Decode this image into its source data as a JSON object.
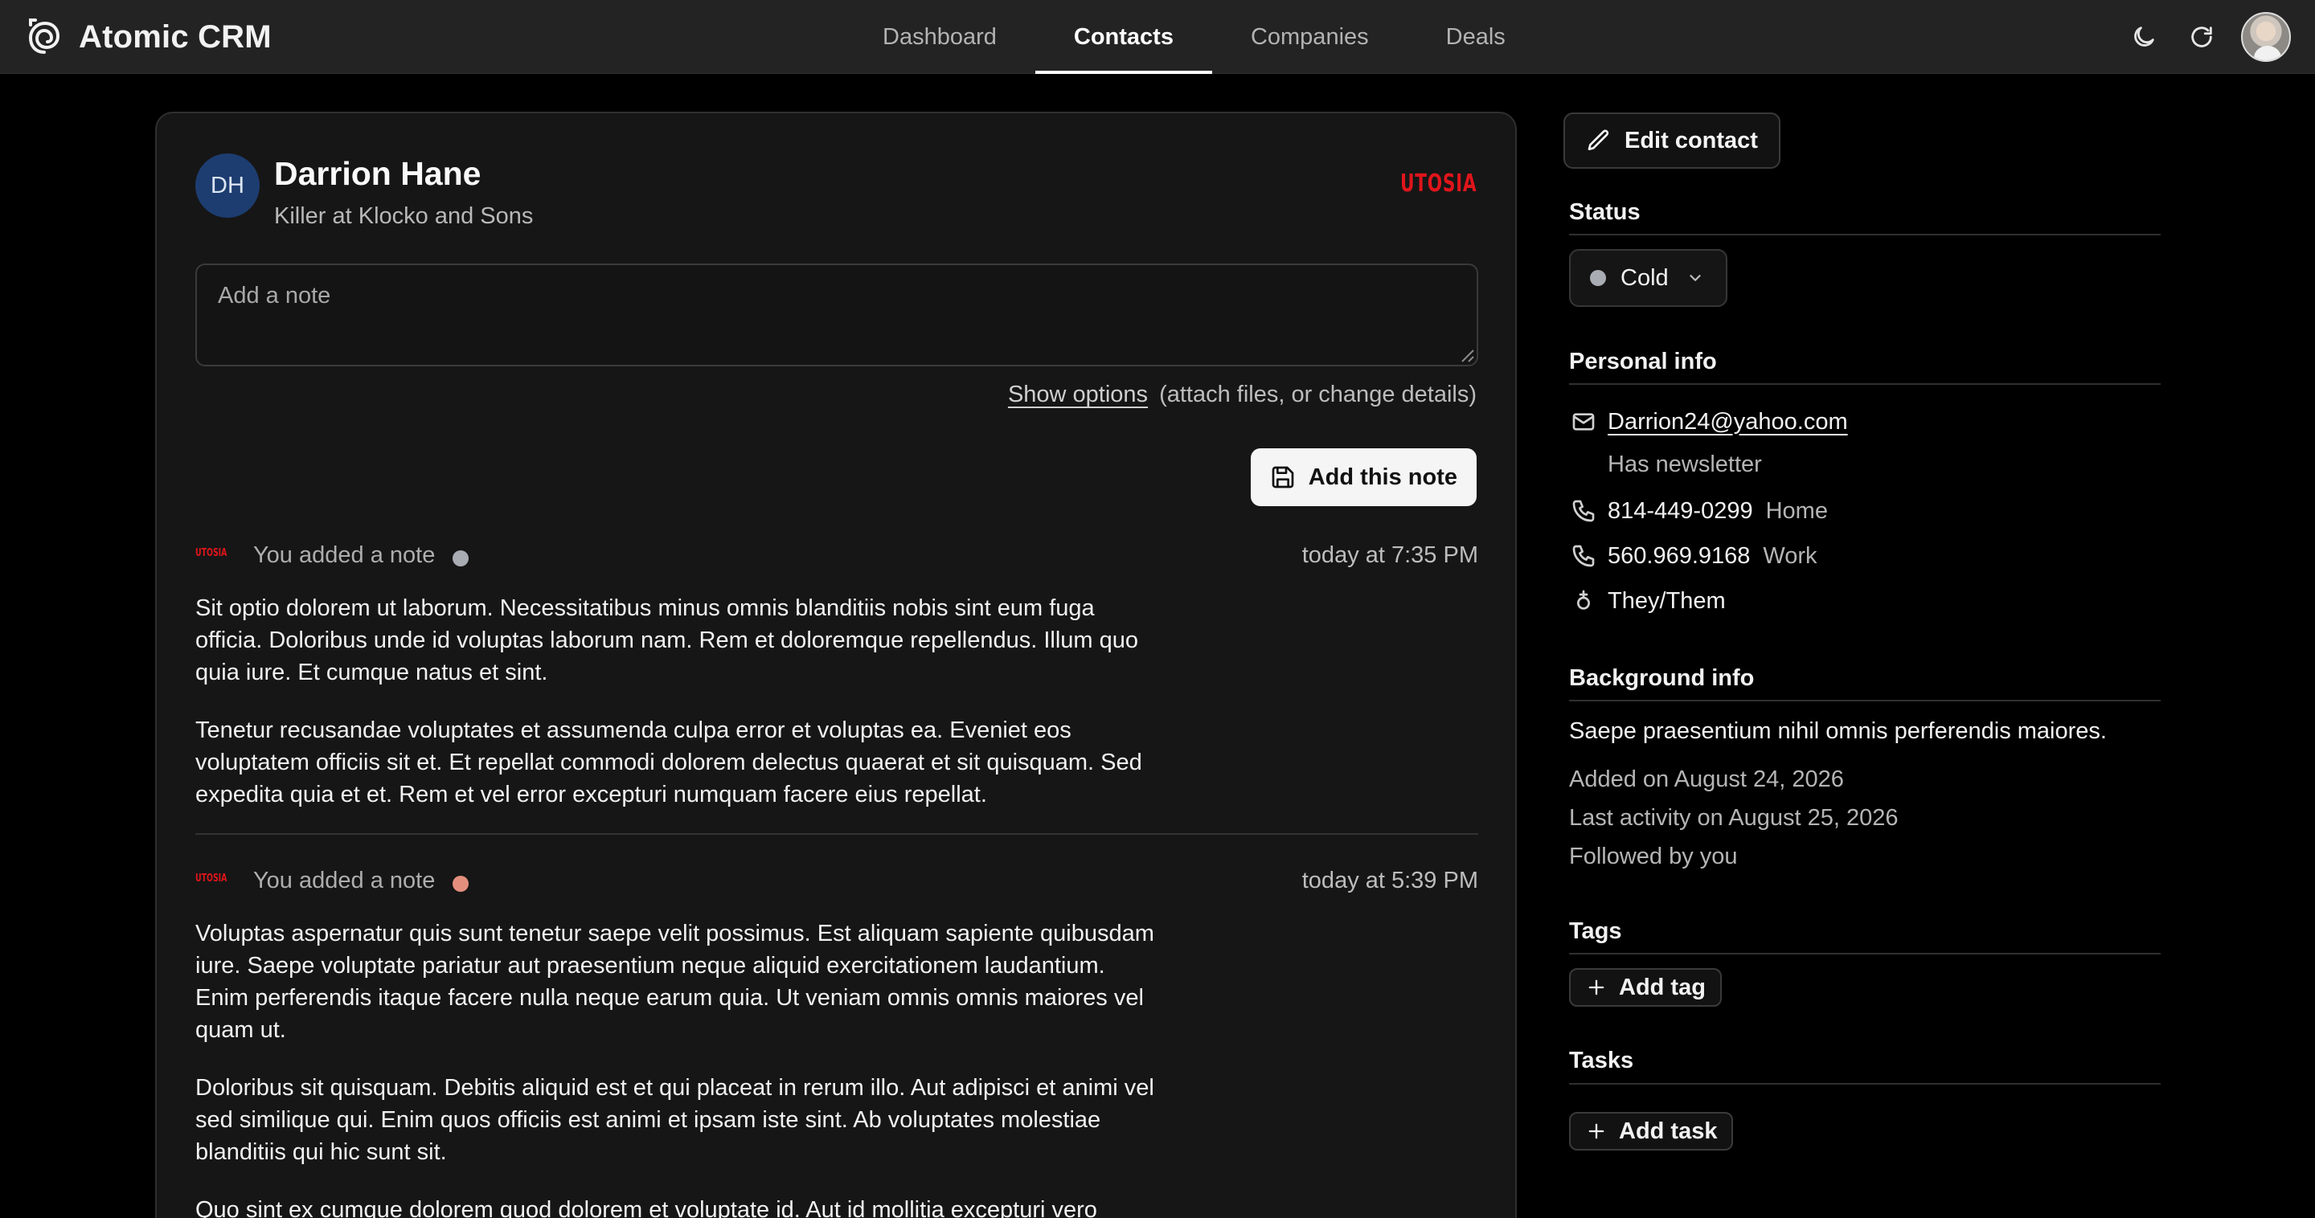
{
  "app": {
    "name": "Atomic CRM"
  },
  "nav": {
    "tabs": [
      {
        "label": "Dashboard",
        "active": false
      },
      {
        "label": "Contacts",
        "active": true
      },
      {
        "label": "Companies",
        "active": false
      },
      {
        "label": "Deals",
        "active": false
      }
    ]
  },
  "top_actions": {
    "icons": [
      "moon-icon",
      "refresh-icon",
      "user-avatar"
    ]
  },
  "contact": {
    "initials": "DH",
    "name": "Darrion Hane",
    "title": "Killer at Klocko and Sons",
    "company_logo_text": "UTOSIA"
  },
  "note_form": {
    "placeholder": "Add a note",
    "show_options": "Show options",
    "options_hint": "(attach files, or change details)",
    "submit_label": "Add this note"
  },
  "notes": [
    {
      "logo_text": "UTOSIA",
      "author": "You added a note",
      "status_color": "#a9acb3",
      "time": "today at 7:35 PM",
      "paragraphs": [
        "Sit optio dolorem ut laborum. Necessitatibus minus omnis blanditiis nobis sint eum fuga officia. Doloribus unde id voluptas laborum nam. Rem et doloremque repellendus. Illum quo quia iure. Et cumque natus et sint.",
        "Tenetur recusandae voluptates et assumenda culpa error et voluptas ea. Eveniet eos voluptatem officiis sit et. Et repellat commodi dolorem delectus quaerat et sit quisquam. Sed expedita quia et et. Rem et vel error excepturi numquam facere eius repellat."
      ]
    },
    {
      "logo_text": "UTOSIA",
      "author": "You added a note",
      "status_color": "#e48f7e",
      "time": "today at 5:39 PM",
      "paragraphs": [
        "Voluptas aspernatur quis sunt tenetur saepe velit possimus. Est aliquam sapiente quibusdam iure. Saepe voluptate pariatur aut praesentium neque aliquid exercitationem laudantium. Enim perferendis itaque facere nulla neque earum quia. Ut veniam omnis omnis maiores vel quam ut.",
        "Doloribus sit quisquam. Debitis aliquid est et qui placeat in rerum illo. Aut adipisci et animi vel sed similique qui. Enim quos officiis est animi et ipsam iste sint. Ab voluptates molestiae blanditiis qui hic sunt sit.",
        "Quo sint ex cumque dolorem quod dolorem et voluptate id. Aut id mollitia excepturi vero"
      ]
    }
  ],
  "sidebar": {
    "edit_label": "Edit contact",
    "status": {
      "title": "Status",
      "value": "Cold",
      "dot_color": "#a9acb3"
    },
    "personal_info": {
      "title": "Personal info",
      "email": "Darrion24@yahoo.com",
      "newsletter": "Has newsletter",
      "phones": [
        {
          "number": "814-449-0299",
          "type": "Home"
        },
        {
          "number": "560.969.9168",
          "type": "Work"
        }
      ],
      "pronouns": "They/Them"
    },
    "background": {
      "title": "Background info",
      "text": "Saepe praesentium nihil omnis perferendis maiores.",
      "added": "Added on August 24, 2026",
      "last_activity": "Last activity on August 25, 2026",
      "followed": "Followed by you"
    },
    "tags": {
      "title": "Tags",
      "add_label": "Add tag"
    },
    "tasks": {
      "title": "Tasks",
      "add_label": "Add task"
    }
  }
}
